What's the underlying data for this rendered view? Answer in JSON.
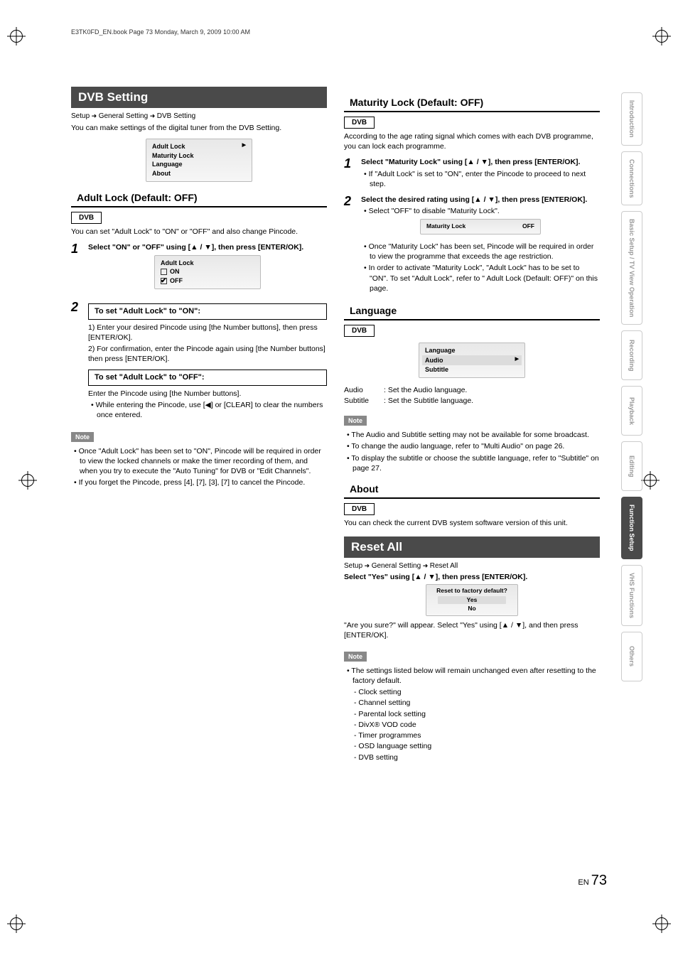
{
  "print_header": "E3TK0FD_EN.book  Page 73  Monday, March 9, 2009  10:00 AM",
  "left": {
    "title": "DVB Setting",
    "breadcrumb": [
      "Setup",
      "General Setting",
      "DVB Setting"
    ],
    "intro": "You can make settings of the digital tuner from the DVB Setting.",
    "menu": [
      "Adult Lock",
      "Maturity Lock",
      "Language",
      "About"
    ],
    "adult_lock": {
      "heading": "Adult Lock (Default: OFF)",
      "dvb": "DVB",
      "intro": "You can set \"Adult Lock\" to \"ON\" or \"OFF\" and also change Pincode.",
      "step1_head": "Select \"ON\" or \"OFF\" using [▲ / ▼], then press [ENTER/OK].",
      "step1_menu_title": "Adult Lock",
      "step1_on": "ON",
      "step1_off": "OFF",
      "step2_box_on": "To set \"Adult Lock\" to \"ON\":",
      "step2_on_1": "1) Enter your desired Pincode using [the Number buttons], then press [ENTER/OK].",
      "step2_on_2": "2) For confirmation, enter the Pincode again using [the Number buttons] then press [ENTER/OK].",
      "step2_box_off": "To set \"Adult Lock\" to \"OFF\":",
      "step2_off_1": "Enter the Pincode using [the Number buttons].",
      "step2_off_2": "While entering the Pincode, use [◀] or [CLEAR] to clear the numbers once entered.",
      "note": "Note",
      "note1": "Once \"Adult Lock\" has been set to \"ON\", Pincode will be required in order to view the locked channels or make the timer recording of them, and when you try to execute the \"Auto Tuning\" for DVB or \"Edit Channels\".",
      "note2": "If you forget the Pincode, press [4], [7], [3], [7] to cancel the Pincode."
    }
  },
  "right": {
    "maturity": {
      "heading": "Maturity Lock (Default: OFF)",
      "dvb": "DVB",
      "intro": "According to the age rating signal which comes with each DVB programme, you can lock each programme.",
      "step1_head": "Select \"Maturity Lock\" using [▲ / ▼], then press [ENTER/OK].",
      "step1_b1": "If \"Adult Lock\" is set to \"ON\", enter the Pincode to proceed to next step.",
      "step2_head": "Select the desired rating using [▲ / ▼], then press [ENTER/OK].",
      "step2_b1": "Select \"OFF\" to disable \"Maturity Lock\".",
      "step2_menu_label": "Maturity Lock",
      "step2_menu_val": "OFF",
      "step2_b2": "Once \"Maturity Lock\" has been set, Pincode will be required in order to view the programme that exceeds the age restriction.",
      "step2_b3": "In order to activate \"Maturity Lock\", \"Adult Lock\" has to be set to \"ON\". To set \"Adult Lock\", refer to \"   Adult Lock (Default: OFF)\" on this page."
    },
    "language": {
      "heading": "Language",
      "dvb": "DVB",
      "menu": [
        "Language",
        "Audio",
        "Subtitle"
      ],
      "audio_label": "Audio",
      "audio_desc": ": Set the Audio language.",
      "sub_label": "Subtitle",
      "sub_desc": ": Set the Subtitle language.",
      "note": "Note",
      "n1": "The Audio and Subtitle setting may not be available for some broadcast.",
      "n2": "To change the audio language, refer to \"Multi Audio\" on page 26.",
      "n3": "To display the subtitle or choose the subtitle language, refer to \"Subtitle\" on page 27."
    },
    "about": {
      "heading": "About",
      "dvb": "DVB",
      "intro": "You can check the current DVB system software version of this unit."
    },
    "reset": {
      "title": "Reset All",
      "breadcrumb": [
        "Setup",
        "General Setting",
        "Reset All"
      ],
      "step_head": "Select \"Yes\" using [▲ / ▼], then press [ENTER/OK].",
      "box_title": "Reset to factory default?",
      "box_yes": "Yes",
      "box_no": "No",
      "after": "\"Are you sure?\" will appear. Select \"Yes\" using [▲ / ▼], and then press [ENTER/OK].",
      "note": "Note",
      "n1": "The settings listed below will remain unchanged even after resetting to the factory default.",
      "items": [
        "Clock setting",
        "Channel setting",
        "Parental lock setting",
        "DivX® VOD code",
        "Timer programmes",
        "OSD language setting",
        "DVB setting"
      ]
    }
  },
  "tabs": [
    "Introduction",
    "Connections",
    "Basic Setup / TV View Operation",
    "Recording",
    "Playback",
    "Editing",
    "Function Setup",
    "VHS Functions",
    "Others"
  ],
  "page_lang": "EN",
  "page_num": "73"
}
